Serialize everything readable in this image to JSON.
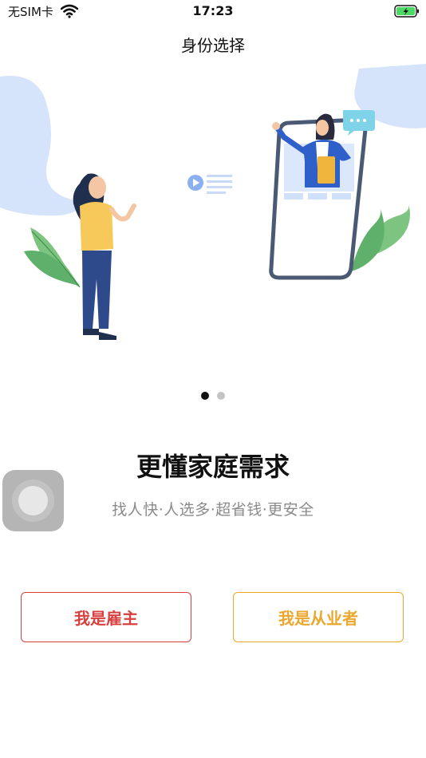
{
  "status_bar": {
    "carrier": "无SIM卡",
    "time": "17:23"
  },
  "nav": {
    "title": "身份选择"
  },
  "pager": {
    "count": 2,
    "active_index": 0
  },
  "content": {
    "headline": "更懂家庭需求",
    "subline": "找人快·人选多·超省钱·更安全"
  },
  "buttons": {
    "employer": "我是雇主",
    "worker": "我是从业者"
  },
  "colors": {
    "employer": "#d8403f",
    "worker": "#eaa72c",
    "accent_blue": "#5a84e2"
  }
}
